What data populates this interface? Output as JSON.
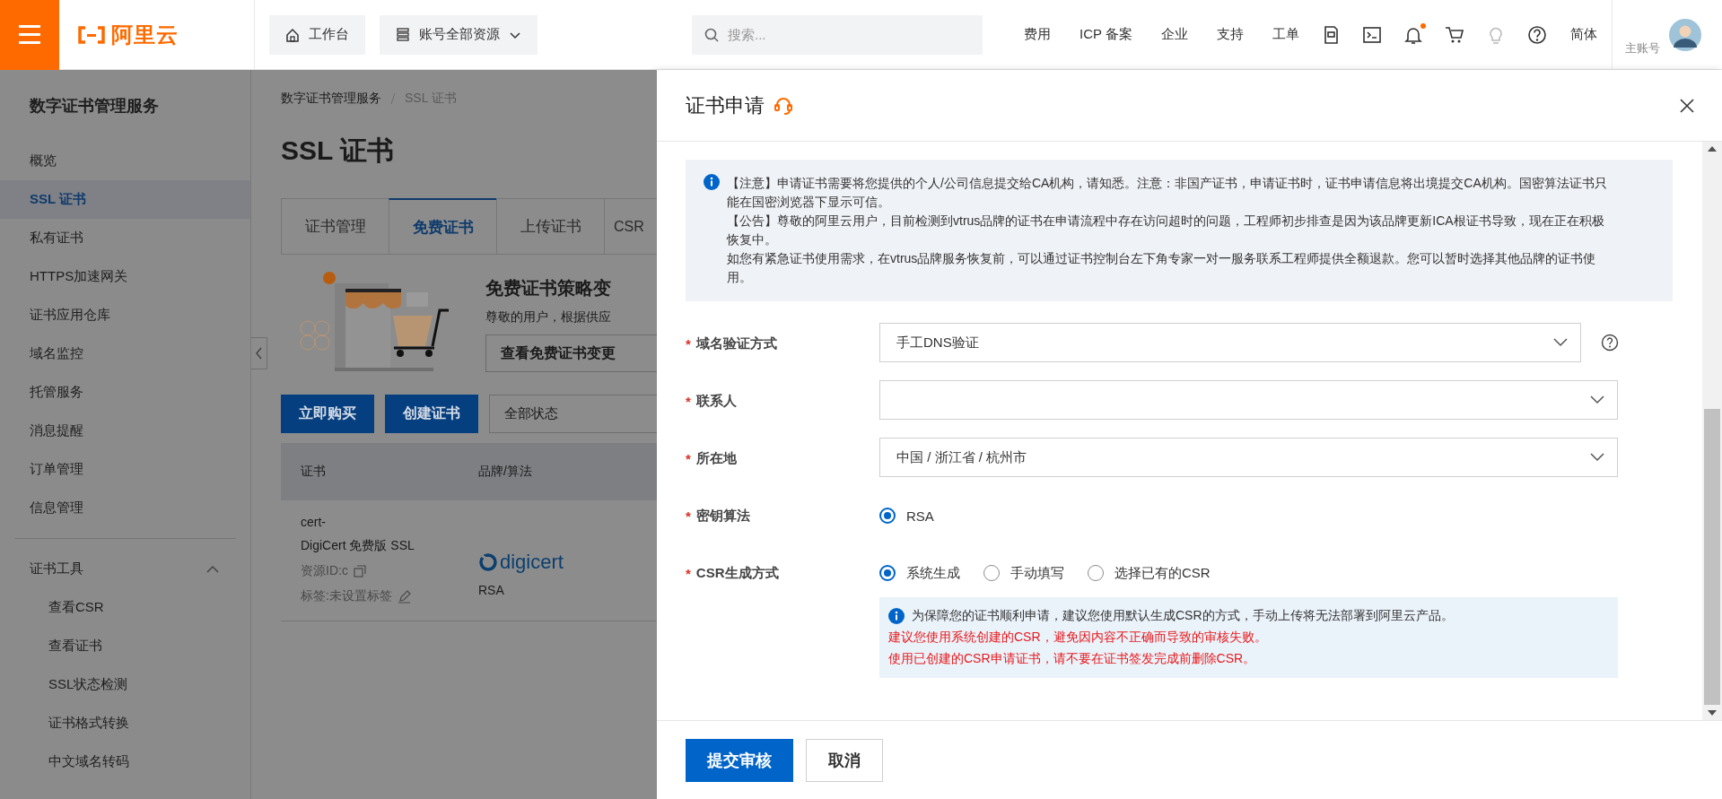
{
  "topbar": {
    "logo_text": "阿里云",
    "workbench": "工作台",
    "resource_scope": "账号全部资源",
    "search": {
      "placeholder": "搜索..."
    },
    "nav": [
      "费用",
      "ICP 备案",
      "企业",
      "支持",
      "工单"
    ],
    "language": "简体",
    "account_type": "主账号"
  },
  "sidebar": {
    "title": "数字证书管理服务",
    "items": [
      {
        "label": "概览",
        "selected": false
      },
      {
        "label": "SSL 证书",
        "selected": true
      },
      {
        "label": "私有证书",
        "selected": false
      },
      {
        "label": "HTTPS加速网关",
        "selected": false
      },
      {
        "label": "证书应用仓库",
        "selected": false
      },
      {
        "label": "域名监控",
        "selected": false
      },
      {
        "label": "托管服务",
        "selected": false
      },
      {
        "label": "消息提醒",
        "selected": false
      },
      {
        "label": "订单管理",
        "selected": false
      },
      {
        "label": "信息管理",
        "selected": false
      }
    ],
    "groups": [
      {
        "label": "证书工具",
        "expanded": true,
        "children": [
          {
            "label": "查看CSR"
          },
          {
            "label": "查看证书"
          },
          {
            "label": "SSL状态检测"
          },
          {
            "label": "证书格式转换"
          },
          {
            "label": "中文域名转码"
          }
        ]
      }
    ]
  },
  "main": {
    "breadcrumb": [
      "数字证书管理服务",
      "SSL 证书"
    ],
    "title": "SSL 证书",
    "tabs": [
      {
        "label": "证书管理",
        "selected": false
      },
      {
        "label": "免费证书",
        "selected": true
      },
      {
        "label": "上传证书",
        "selected": false
      },
      {
        "label": "CSR",
        "selected": false
      }
    ],
    "promo": {
      "title": "免费证书策略变",
      "text": "尊敬的用户，根据供应",
      "button": "查看免费证书变更"
    },
    "actions": [
      "立即购买",
      "创建证书"
    ],
    "status_filter": "全部状态",
    "table": {
      "columns": [
        "证书",
        "品牌/算法"
      ],
      "rows": [
        {
          "name": "cert-",
          "product": "DigiCert 免费版 SSL",
          "resource_id": "资源ID:c",
          "tags": "标签:未设置标签",
          "brand": "digicert",
          "algorithm": "RSA"
        }
      ]
    }
  },
  "drawer": {
    "title": "证书申请",
    "notice": [
      "【注意】申请证书需要将您提供的个人/公司信息提交给CA机构，请知悉。注意：非国产证书，申请证书时，证书申请信息将出境提交CA机构。国密算法证书只能在国密浏览器下显示可信。",
      "【公告】尊敬的阿里云用户，目前检测到vtrus品牌的证书在申请流程中存在访问超时的问题，工程师初步排查是因为该品牌更新ICA根证书导致，现在正在积极恢复中。",
      "如您有紧急证书使用需求，在vtrus品牌服务恢复前，可以通过证书控制台左下角专家一对一服务联系工程师提供全额退款。您可以暂时选择其他品牌的证书使用。"
    ],
    "fields": [
      {
        "kind": "select",
        "required_mark": "*",
        "label": "域名验证方式",
        "value": "手工DNS验证",
        "help": true
      },
      {
        "kind": "select",
        "required_mark": "*",
        "label": "联系人",
        "help": false
      },
      {
        "kind": "select",
        "required_mark": "*",
        "label": "所在地",
        "value": "中国 / 浙江省 / 杭州市",
        "help": false
      },
      {
        "kind": "radio",
        "required_mark": "*",
        "label": "密钥算法",
        "options": [
          {
            "label": "RSA",
            "selected": true
          }
        ]
      },
      {
        "kind": "radio",
        "required_mark": "*",
        "label": "CSR生成方式",
        "options": [
          {
            "label": "系统生成",
            "selected": true
          },
          {
            "label": "手动填写",
            "selected": false
          },
          {
            "label": "选择已有的CSR",
            "selected": false
          }
        ],
        "tip": {
          "info": "为保障您的证书顺利申请，建议您使用默认生成CSR的方式，手动上传将无法部署到阿里云产品。",
          "warnings": [
            "建议您使用系统创建的CSR，避免因内容不正确而导致的审核失败。",
            "使用已创建的CSR申请证书，请不要在证书签发完成前删除CSR。"
          ]
        }
      }
    ],
    "buttons": [
      {
        "label": "提交审核",
        "kind": "primary"
      },
      {
        "label": "取消",
        "kind": "default"
      }
    ]
  }
}
